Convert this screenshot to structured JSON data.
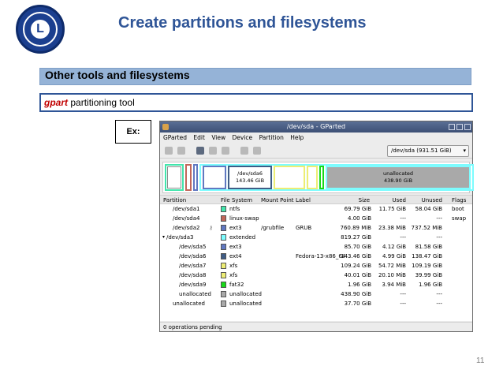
{
  "slide": {
    "title": "Create partitions and filesystems",
    "section_header": "Other tools and filesystems",
    "tool_name": "gpart",
    "tool_desc": "partitioning tool",
    "example_label": "Ex:",
    "page_number": "11",
    "logo_letter": "L"
  },
  "gparted": {
    "title": "/dev/sda - GParted",
    "menu": [
      "GParted",
      "Edit",
      "View",
      "Device",
      "Partition",
      "Help"
    ],
    "device_select": "/dev/sda  (931.51 GiB)",
    "diskmap": {
      "selected_name": "/dev/sda6",
      "selected_size": "143.46 GiB",
      "unalloc_name": "unallocated",
      "unalloc_size": "438.90 GiB"
    },
    "columns": [
      "Partition",
      "File System",
      "Mount Point",
      "Label",
      "Size",
      "Used",
      "Unused",
      "Flags"
    ],
    "rows": [
      {
        "partition": "/dev/sda1",
        "fs": "ntfs",
        "color": "#42e5ac",
        "mount": "",
        "label": "",
        "size": "69.79 GiB",
        "used": "11.75 GiB",
        "unused": "58.04 GiB",
        "flags": "boot"
      },
      {
        "partition": "/dev/sda4",
        "fs": "linux-swap",
        "color": "#c1665a",
        "mount": "",
        "label": "",
        "size": "4.00 GiB",
        "used": "---",
        "unused": "---",
        "flags": "swap"
      },
      {
        "partition": "/dev/sda2",
        "fs": "ext3",
        "color": "#6178c1",
        "mount": "/grubfile",
        "label": "GRUB",
        "size": "760.89 MiB",
        "used": "23.38 MiB",
        "unused": "737.52 MiB",
        "flags": ""
      },
      {
        "partition": "/dev/sda3",
        "fs": "extended",
        "color": "#7dfcfe",
        "mount": "",
        "label": "",
        "size": "819.27 GiB",
        "used": "---",
        "unused": "---",
        "flags": ""
      },
      {
        "partition": "/dev/sda5",
        "fs": "ext3",
        "color": "#6178c1",
        "mount": "",
        "label": "",
        "size": "85.70 GiB",
        "used": "4.12 GiB",
        "unused": "81.58 GiB",
        "flags": ""
      },
      {
        "partition": "/dev/sda6",
        "fs": "ext4",
        "color": "#3f5c85",
        "mount": "",
        "label": "Fedora-13-x86_64",
        "size": "143.46 GiB",
        "used": "4.99 GiB",
        "unused": "138.47 GiB",
        "flags": ""
      },
      {
        "partition": "/dev/sda7",
        "fs": "xfs",
        "color": "#eded74",
        "mount": "",
        "label": "",
        "size": "109.24 GiB",
        "used": "54.72 MiB",
        "unused": "109.19 GiB",
        "flags": ""
      },
      {
        "partition": "/dev/sda8",
        "fs": "xfs",
        "color": "#eded74",
        "mount": "",
        "label": "",
        "size": "40.01 GiB",
        "used": "20.10 MiB",
        "unused": "39.99 GiB",
        "flags": ""
      },
      {
        "partition": "/dev/sda9",
        "fs": "fat32",
        "color": "#18d918",
        "mount": "",
        "label": "",
        "size": "1.96 GiB",
        "used": "3.94 MiB",
        "unused": "1.96 GiB",
        "flags": ""
      },
      {
        "partition": "unallocated",
        "fs": "unallocated",
        "color": "#a9a9a9",
        "mount": "",
        "label": "",
        "size": "438.90 GiB",
        "used": "---",
        "unused": "---",
        "flags": ""
      },
      {
        "partition": "unallocated",
        "fs": "unallocated",
        "color": "#a9a9a9",
        "mount": "",
        "label": "",
        "size": "37.70 GiB",
        "used": "---",
        "unused": "---",
        "flags": ""
      }
    ],
    "status": "0 operations pending"
  }
}
